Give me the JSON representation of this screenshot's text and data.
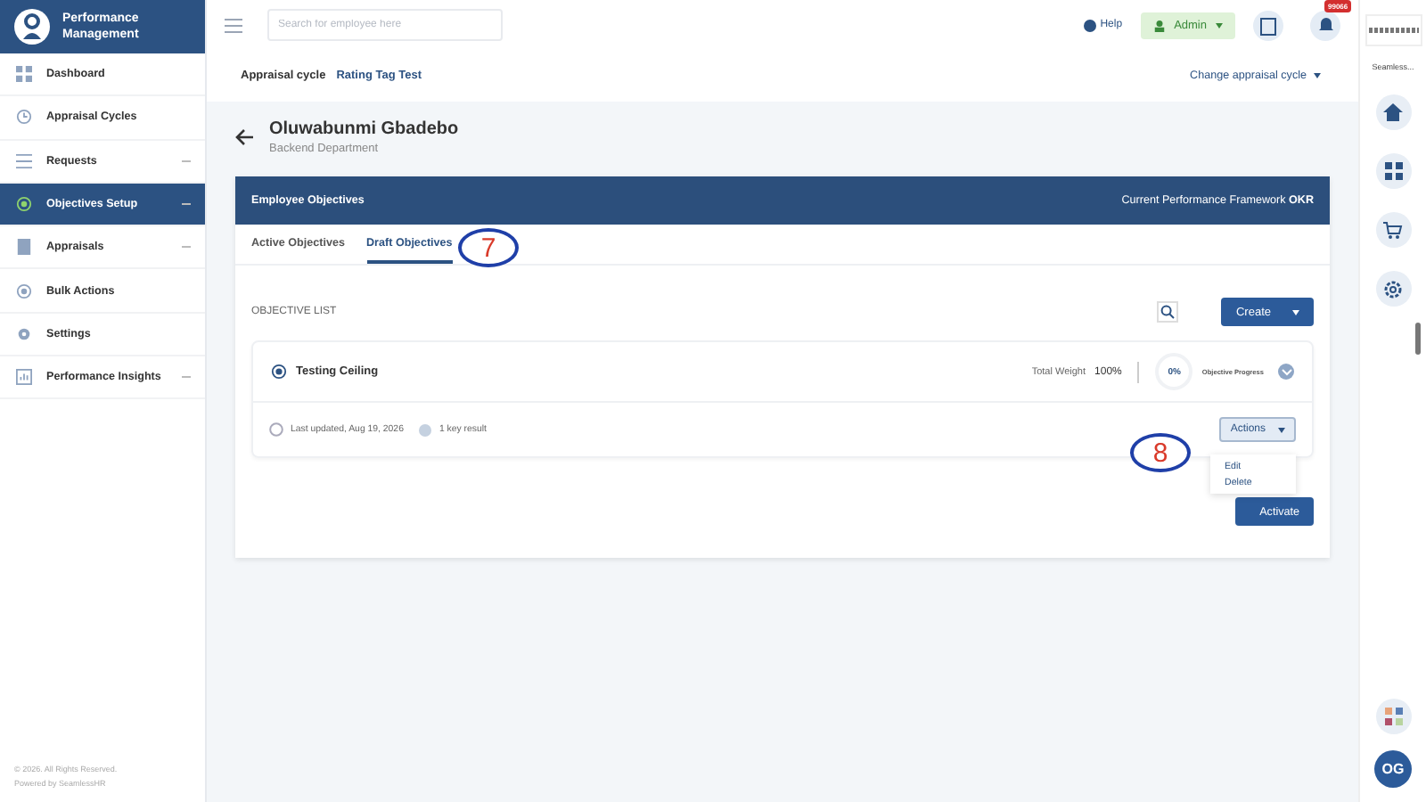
{
  "brand": {
    "title": "Performance Management"
  },
  "sidebar": {
    "items": [
      {
        "label": "Dashboard",
        "expandable": false,
        "selected": false
      },
      {
        "label": "Appraisal Cycles",
        "expandable": false,
        "selected": false
      },
      {
        "label": "Requests",
        "expandable": true,
        "selected": false
      },
      {
        "label": "Objectives Setup",
        "expandable": true,
        "selected": true
      },
      {
        "label": "Appraisals",
        "expandable": true,
        "selected": false
      },
      {
        "label": "Bulk Actions",
        "expandable": false,
        "selected": false
      },
      {
        "label": "Settings",
        "expandable": false,
        "selected": false
      },
      {
        "label": "Performance Insights",
        "expandable": true,
        "selected": false
      }
    ],
    "footer": [
      "© 2026. All Rights Reserved.",
      "Powered by SeamlessHR"
    ]
  },
  "topbar": {
    "search": {
      "placeholder": "Search for employee here"
    },
    "help": "Help",
    "role": "Admin",
    "notification_count": "99066"
  },
  "cycle": {
    "label": "Appraisal cycle",
    "value": "Rating Tag Test",
    "change": "Change appraisal cycle"
  },
  "employee": {
    "name": "Oluwabunmi Gbadebo",
    "department": "Backend Department"
  },
  "panel": {
    "title": "Employee Objectives",
    "framework": "Current Performance Framework **OKR**",
    "tabs": [
      {
        "label": "Active Objectives",
        "selected": false
      },
      {
        "label": "Draft Objectives",
        "selected": true
      }
    ],
    "list_title": "OBJECTIVE LIST",
    "create": "Create",
    "objective": {
      "title": "Testing Ceiling",
      "weight_label": "Total Weight",
      "weight": "100%",
      "progress": "0%",
      "progress_label": "Objective Progress",
      "updated": "Last updated, Aug 19, 2026",
      "key_results": "1 key result",
      "actions": "Actions"
    },
    "menu": [
      "Edit",
      "Delete"
    ],
    "activate": "Activate"
  },
  "rail": {
    "caption": "Seamless..."
  },
  "avatar": {
    "initials": "OG"
  },
  "annotations": [
    {
      "label": "7"
    },
    {
      "label": "8"
    }
  ]
}
